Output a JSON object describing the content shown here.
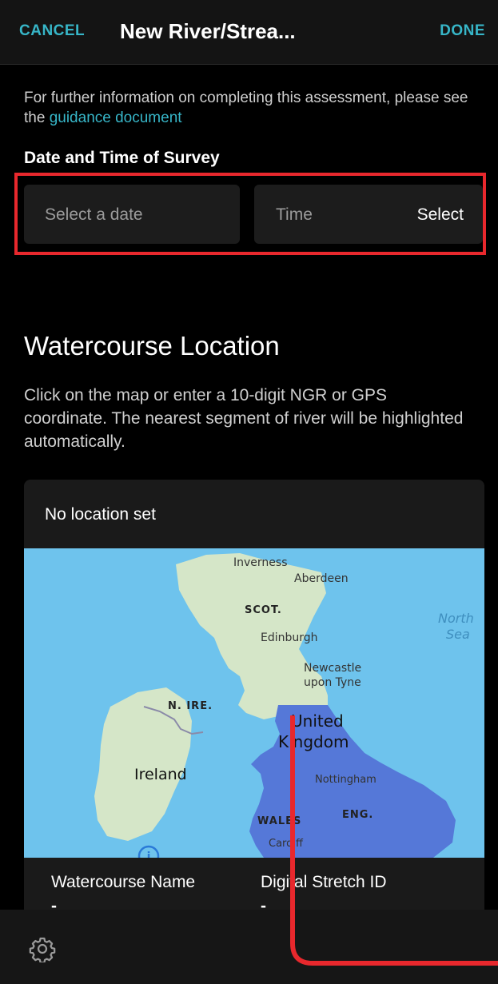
{
  "header": {
    "cancel_label": "CANCEL",
    "title": "New River/Strea...",
    "done_label": "DONE"
  },
  "intro": {
    "text": "For further information on completing this assessment, please see the ",
    "link": "guidance document"
  },
  "date_section": {
    "label": "Date and Time of Survey",
    "date_placeholder": "Select a date",
    "time_placeholder": "Time",
    "time_select_label": "Select"
  },
  "watercourse": {
    "title": "Watercourse Location",
    "description": "Click on the map or enter a 10-digit NGR or GPS coordinate. The nearest segment of river will be highlighted automatically.",
    "location_status": "No location set",
    "name_label": "Watercourse Name",
    "name_value": "-",
    "stretch_label": "Digital Stretch ID",
    "stretch_value": "-"
  },
  "map": {
    "labels": {
      "inverness": "Inverness",
      "aberdeen": "Aberdeen",
      "scot": "SCOT.",
      "edinburgh": "Edinburgh",
      "newcastle_1": "Newcastle",
      "newcastle_2": "upon Tyne",
      "n_ire": "N. IRE.",
      "united": "United",
      "kingdom": "Kingdom",
      "ireland": "Ireland",
      "nottingham": "Nottingham",
      "wales": "WALES",
      "eng": "ENG.",
      "cardiff": "Cardiff",
      "north": "North",
      "sea": "Sea"
    }
  },
  "colors": {
    "accent": "#37b6c8",
    "highlight": "#e8282d",
    "sea": "#6ec3ed",
    "land": "#d5e6c8",
    "overlay": "#5578d8"
  },
  "icons": {
    "settings": "gear-icon",
    "info": "info-icon"
  }
}
